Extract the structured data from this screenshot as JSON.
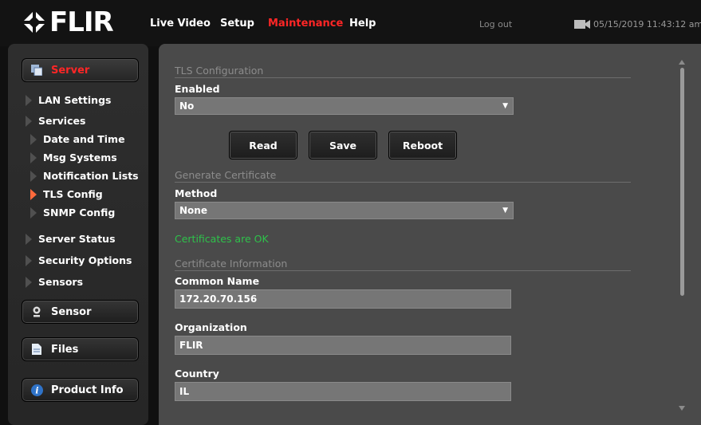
{
  "header": {
    "logo_text": "FLIR",
    "nav": [
      {
        "label": "Live Video",
        "active": false
      },
      {
        "label": "Setup",
        "active": false
      },
      {
        "label": "Maintenance",
        "active": true
      },
      {
        "label": "Help",
        "active": false
      }
    ],
    "logout_label": "Log out",
    "datetime": "05/15/2019 11:43:12 am",
    "camera_icon": "camera-icon"
  },
  "sidebar": {
    "server_label": "Server",
    "items": [
      {
        "label": "LAN Settings"
      },
      {
        "label": "Services"
      },
      {
        "label": "Date and Time"
      },
      {
        "label": "Msg Systems"
      },
      {
        "label": "Notification Lists"
      },
      {
        "label": "TLS Config",
        "active": true
      },
      {
        "label": "SNMP Config"
      },
      {
        "label": "Server Status"
      },
      {
        "label": "Security Options"
      },
      {
        "label": "Sensors"
      }
    ],
    "sensor_label": "Sensor",
    "files_label": "Files",
    "product_info_label": "Product Info"
  },
  "main": {
    "tls_section": "TLS Configuration",
    "enabled_label": "Enabled",
    "enabled_value": "No",
    "buttons": {
      "read": "Read",
      "save": "Save",
      "reboot": "Reboot"
    },
    "generate_section": "Generate Certificate",
    "method_label": "Method",
    "method_value": "None",
    "status": "Certificates are OK",
    "cert_info_section": "Certificate Information",
    "common_name_label": "Common Name",
    "common_name_value": "172.20.70.156",
    "organization_label": "Organization",
    "organization_value": "FLIR",
    "country_label": "Country",
    "country_value": "IL"
  },
  "colors": {
    "accent": "#ff2626",
    "status_ok": "#2ec24a",
    "active_arrow": "#ff6a3c"
  }
}
